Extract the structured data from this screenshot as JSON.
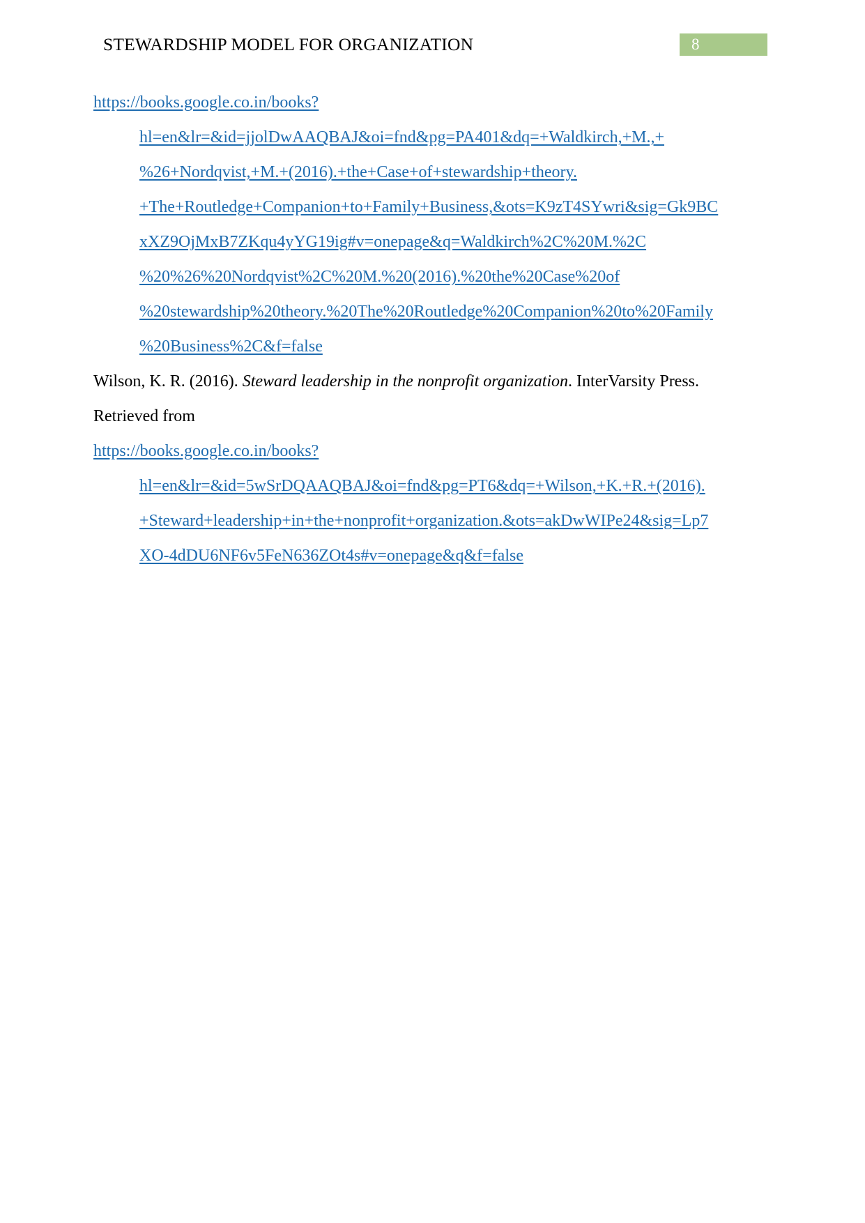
{
  "header": {
    "running_head": "STEWARDSHIP MODEL FOR ORGANIZATION",
    "page_number": "8",
    "badge_color": "#a8c98a",
    "page_number_color": "#ffffff"
  },
  "theme": {
    "link_color": "#1f6cb0",
    "text_color": "#000000",
    "background": "#ffffff"
  },
  "references": {
    "block1": {
      "url_root": "https://books.google.co.in/books?",
      "continuation_lines": [
        "hl=en&lr=&id=jjolDwAAQBAJ&oi=fnd&pg=PA401&dq=+Waldkirch,+M.,+",
        "%26+Nordqvist,+M.+(2016).+the+Case+of+stewardship+theory.",
        "+The+Routledge+Companion+to+Family+Business,&ots=K9zT4SYwri&sig=Gk9BC",
        "xXZ9OjMxB7ZKqu4yYG19ig#v=onepage&q=Waldkirch%2C%20M.%2C",
        "%20%26%20Nordqvist%2C%20M.%20(2016).%20the%20Case%20of",
        "%20stewardship%20theory.%20The%20Routledge%20Companion%20to%20Family",
        "%20Business%2C&f=false"
      ]
    },
    "citation_wilson": {
      "part1": "Wilson, K. R. (2016). ",
      "title_italic": "Steward leadership in the nonprofit organization",
      "part2": ". InterVarsity Press.",
      "retrieved_label": "Retrieved from"
    },
    "block2": {
      "url_root": "https://books.google.co.in/books?",
      "continuation_lines": [
        "hl=en&lr=&id=5wSrDQAAQBAJ&oi=fnd&pg=PT6&dq=+Wilson,+K.+R.+(2016).",
        "+Steward+leadership+in+the+nonprofit+organization.&ots=akDwWIPe24&sig=Lp7",
        "XO-4dDU6NF6v5FeN636ZOt4s#v=onepage&q&f=false"
      ]
    }
  }
}
